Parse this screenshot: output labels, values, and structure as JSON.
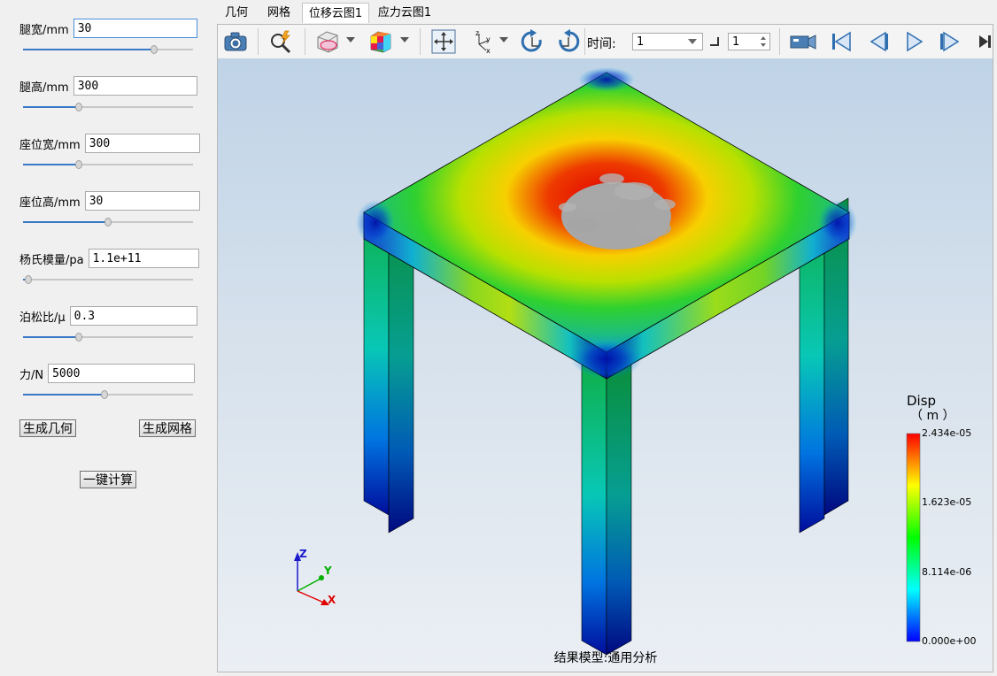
{
  "params": [
    {
      "label": "腿宽/mm",
      "value": "30",
      "slider_percent": 77
    },
    {
      "label": "腿高/mm",
      "value": "300",
      "slider_percent": 33
    },
    {
      "label": "座位宽/mm",
      "value": "300",
      "slider_percent": 33
    },
    {
      "label": "座位高/mm",
      "value": "30",
      "slider_percent": 50
    },
    {
      "label": "杨氏模量/pa",
      "value": "1.1e+11",
      "slider_percent": 3
    },
    {
      "label": "泊松比/μ",
      "value": "0.3",
      "slider_percent": 33
    },
    {
      "label": "力/N",
      "value": "5000",
      "slider_percent": 48
    }
  ],
  "buttons": {
    "gen_geometry": "生成几何",
    "gen_mesh": "生成网格",
    "compute": "一键计算"
  },
  "tabs": [
    {
      "label": "几何",
      "active": false
    },
    {
      "label": "网格",
      "active": false
    },
    {
      "label": "位移云图1",
      "active": true
    },
    {
      "label": "应力云图1",
      "active": false
    }
  ],
  "toolbar": {
    "time_label": "时间:",
    "time_value": "1",
    "step_value": "1"
  },
  "legend": {
    "title": "Disp",
    "unit": "（ m ）",
    "ticks": [
      "2.434e-05",
      "1.623e-05",
      "8.114e-06",
      "0.000e+00"
    ],
    "colors": [
      "#ff0000",
      "#ffff00",
      "#00ff00",
      "#00ffff",
      "#0000ff"
    ]
  },
  "axes": {
    "z": "Z",
    "y": "Y",
    "x": "X"
  },
  "model_caption": "结果模型:通用分析"
}
